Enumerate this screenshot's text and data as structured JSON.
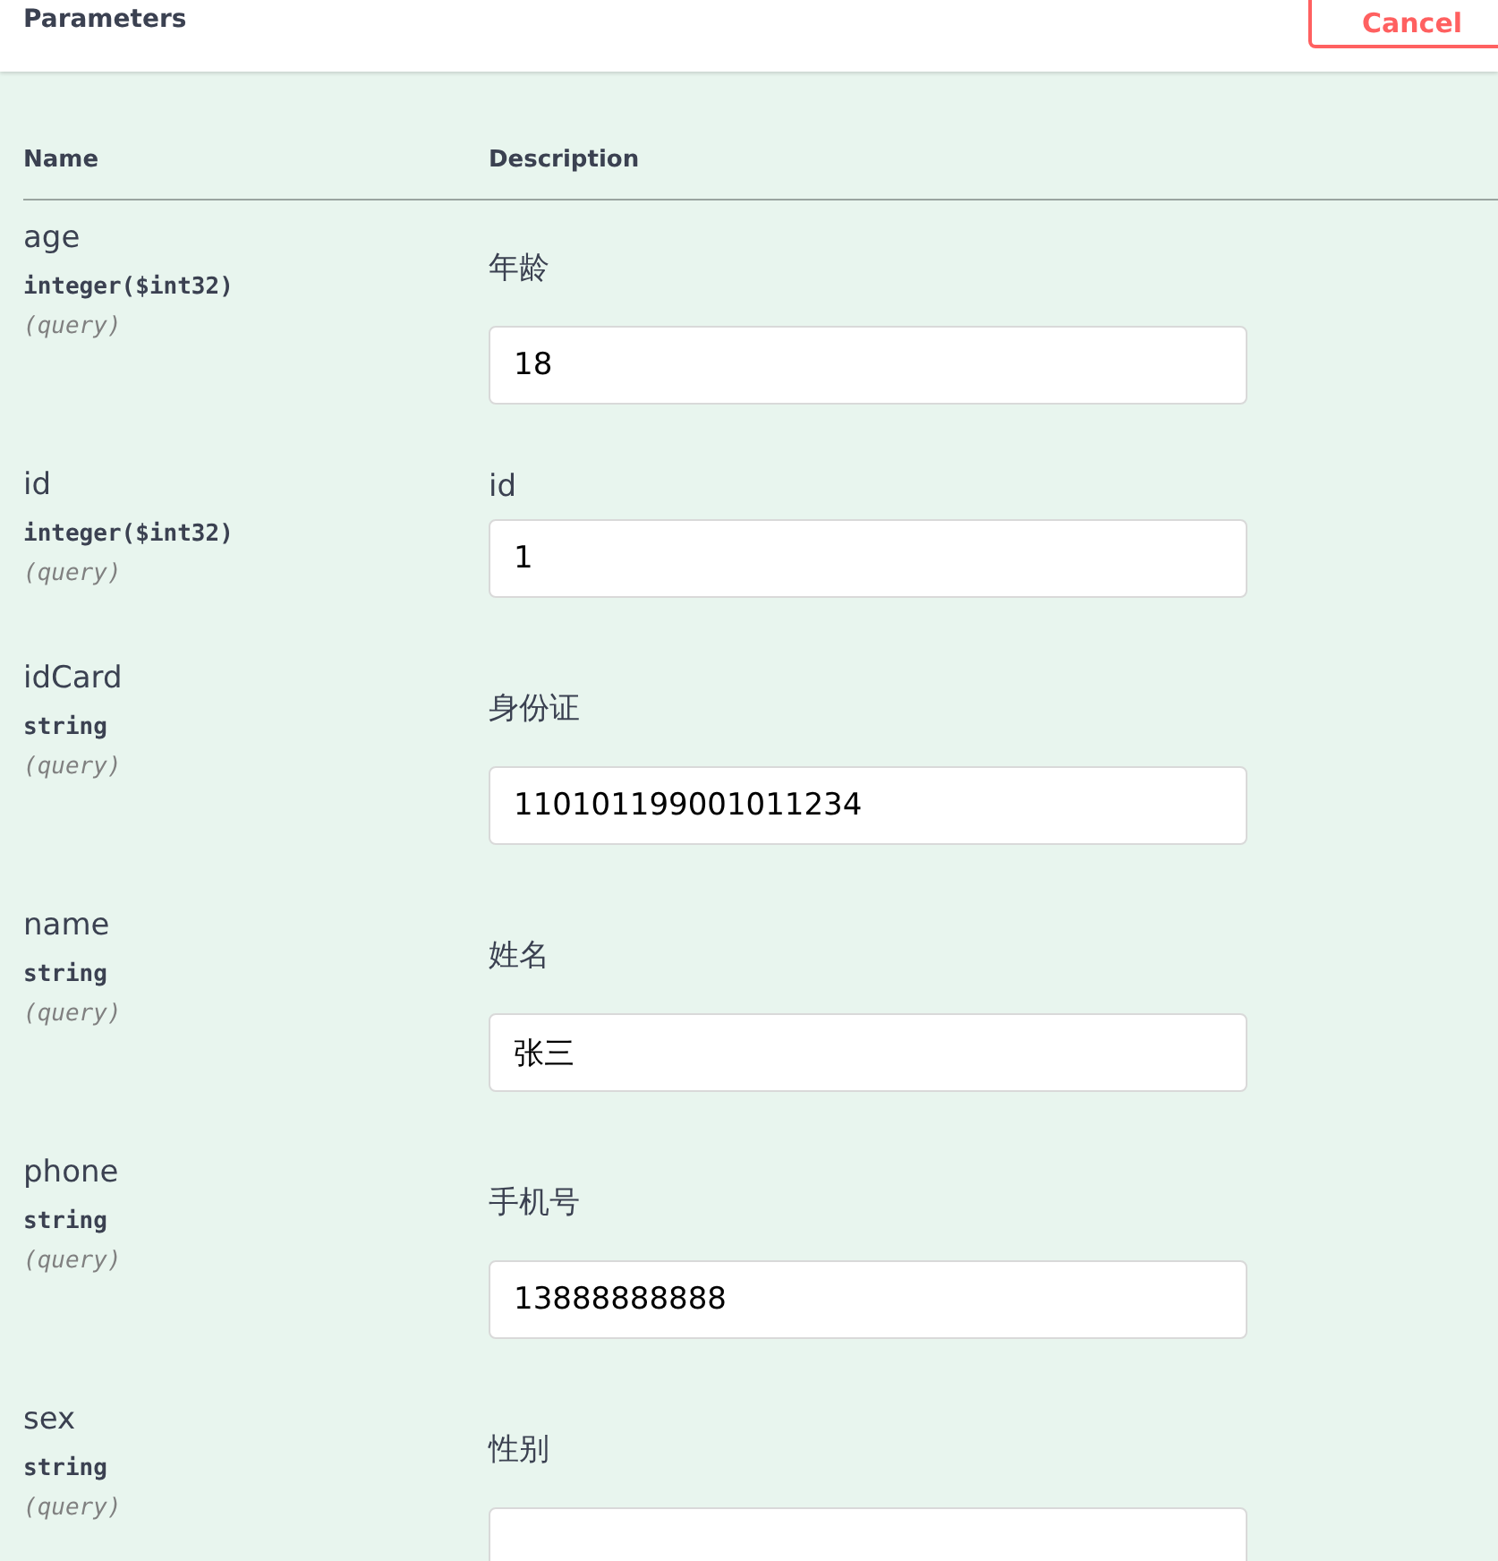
{
  "header": {
    "title": "Parameters",
    "cancel_button": "Cancel"
  },
  "table": {
    "columns": [
      "Name",
      "Description"
    ],
    "rows": [
      {
        "name": "age",
        "type": "integer($int32)",
        "location": "(query)",
        "kind": "markdown",
        "description": "年龄",
        "value": "18"
      },
      {
        "name": "id",
        "type": "integer($int32)",
        "location": "(query)",
        "kind": "plain",
        "description": "id",
        "value": "1"
      },
      {
        "name": "idCard",
        "type": "string",
        "location": "(query)",
        "kind": "markdown",
        "description": "身份证",
        "value": "110101199001011234"
      },
      {
        "name": "name",
        "type": "string",
        "location": "(query)",
        "kind": "markdown",
        "description": "姓名",
        "value": "张三"
      },
      {
        "name": "phone",
        "type": "string",
        "location": "(query)",
        "kind": "markdown",
        "description": "手机号",
        "value": "13888888888"
      },
      {
        "name": "sex",
        "type": "string",
        "location": "(query)",
        "kind": "markdown",
        "description": "性别"
      }
    ]
  }
}
